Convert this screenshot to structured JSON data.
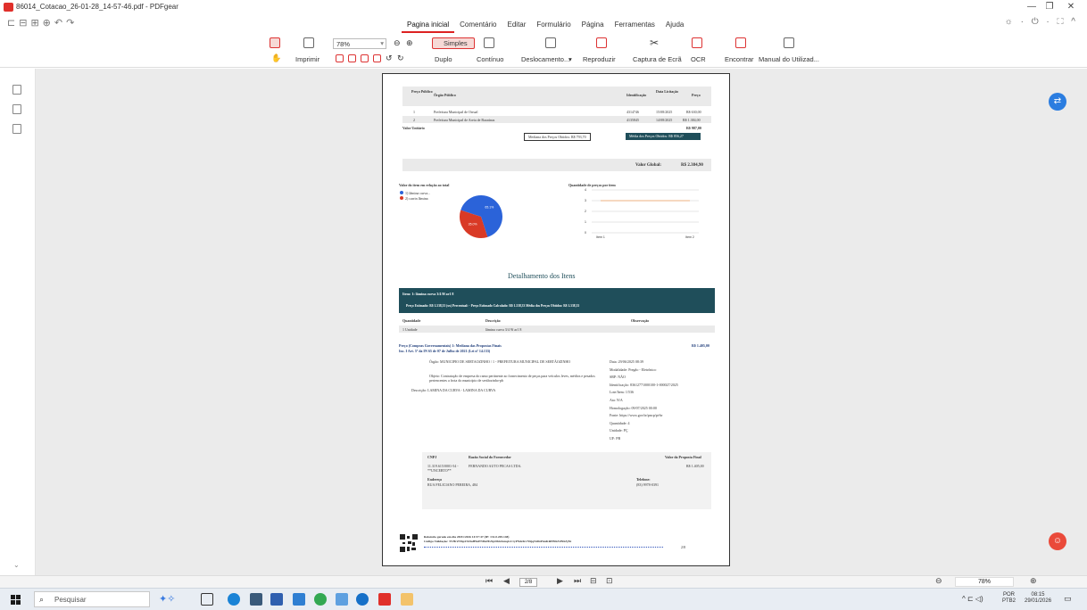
{
  "window": {
    "title": "86014_Cotacao_26-01-28_14-57-46.pdf - PDFgear",
    "logo": "gear",
    "minimize": "—",
    "maximize": "❐",
    "close": "✕"
  },
  "quickbar": {
    "icons": [
      "open-icon",
      "save-icon",
      "print-icon",
      "share-icon",
      "undo-icon",
      "redo-icon"
    ]
  },
  "menu": [
    "Pagina inicial",
    "Comentário",
    "Editar",
    "Formulário",
    "Página",
    "Ferramentas",
    "Ajuda"
  ],
  "right_tools": "☼ · ⏻ · ⛶ ^",
  "ribbon": {
    "zoom": "78%",
    "print": "Imprimir",
    "simples": "Simples",
    "duplo": "Duplo",
    "continuo": "Contínuo",
    "deslocamento": "Deslocamento...",
    "reproduzir": "Reproduzir",
    "captura": "Captura de Ecrã",
    "ocr": "OCR",
    "encontrar": "Encontrar",
    "manual": "Manual do Utilizad..."
  },
  "doc": {
    "t1_head": [
      "Preço Público",
      "Órgão Público",
      "Identificação",
      "Data Licitação",
      "Preço"
    ],
    "t1_rows": [
      [
        "1",
        "Prefeitura Municipal de Orrual",
        "4314746",
        "15/08/2025",
        "R$ 630,00"
      ],
      [
        "2",
        "Prefeitura Municipal de Areia de Baraúnas",
        "4135845",
        "14/08/2025",
        "R$ 1.384,00"
      ]
    ],
    "valor_unitario": "Valor Unitário",
    "valor_unitario_val": "R$ 987,00",
    "mediana": "Mediana dos Preços Obtidos: R$ 793,70",
    "media": "Média dos Preços Obtidos: R$ 856,27",
    "valor_global_label": "Valor Global:",
    "valor_global": "R$ 2.384,90",
    "pie_title": "Valor do item em relação ao total",
    "legend1": "1) lâmina curva...",
    "legend2": "2) carrin lâmina",
    "bar_title": "Quantidade de preços por item",
    "detalhamento": "Detalhamento dos Itens",
    "item_title": "Item: 1: lâmina curva 3/4 9f ar1 8",
    "item_line": "Preço Estimado: R$ 1.538,33 (xx)        Percentual: -        Preço Estimado Calculado: R$ 1.538,33        Média dos Preços Obtidos: R$ 1.538,33",
    "qtd_head": [
      "Quantidade",
      "Descrição",
      "Observação"
    ],
    "qtd_row": [
      "1 Unidade",
      "lâmina curva 3/4 9f ar1 8",
      ""
    ],
    "preco_title": "Preço (Compras Governamentais) 1: Mediana das Propostas Finais",
    "preco_val": "R$ 1.405,00",
    "preco_sub": "Inc. I Art. 5º da IN 65 de 07 de Julho de 2021 (Lei nº 14.133)",
    "orgao": "Órgão:  MUNICIPIO DE SERTAOZINHO / 1 - PREFEITURA MUNICIPAL DE SERTÃOZINHO",
    "objeto": "Objeto:  Contratação de empresa do ramo pertinente ao fornecimento de peças para veículos leves, médios e pesados pertencentes a frota do município de sertãozinho-pb",
    "descricao": "Descrição:  LAMINA DA CURVA - LAMINA DA CURVA",
    "right_info": [
      "Data: 29/06/2025 08:39",
      "Modalidade: Pregão - Eletrônico",
      "SRP: NÃO",
      "Identificação: 83612771000100-1-000027/2025",
      "Lote/Item: 1/536",
      "Ata: N/A",
      "Homologação: 09/07/2025 00:00",
      "Fonte: https://www.gov.br/pncp/pt-br",
      "Quantidade: 4",
      "Unidade: PÇ",
      "UF: PB"
    ],
    "cnpj_head": [
      "CNPJ",
      "Razão Social do Fornecedor",
      "Valor da Proposta Final"
    ],
    "cnpj_row": [
      "11.319.615/0001-54 - **UNCERTO**",
      "FERNANDO AUTO PECAS LTDA.",
      "R$ 1.405,00"
    ],
    "endereco_label": "Endereço",
    "endereco": "RUA FELICIANO PEREIRA, 484",
    "telefone_label": "Telefone:",
    "telefone": "(83) 9978-0391",
    "footer": "Relatório gerado em dia 28/01/2026 14:57:47 (IP: 131.0.205.148)",
    "footer2": "Código Validação: 5VHrZNbpZXDaH9nPNf6xHxNpD6GKmqGC1yPNdzfzv70tjqNdbtPtmKRHN6ZtfN6ZjNt"
  },
  "status": {
    "page": "2/8"
  },
  "zoom_status": "78%",
  "taskbar": {
    "search": "Pesquisar",
    "lang1": "POR",
    "lang2": "PTB2",
    "time": "08:15",
    "date": "29/01/2026"
  },
  "chart_data": [
    {
      "type": "pie",
      "title": "Valor do item em relação ao total",
      "categories": [
        "1) lâmina curva...",
        "2) carrin lâmina"
      ],
      "values": [
        65.1,
        35.0
      ],
      "colors": [
        "#2b63d9",
        "#d93a26"
      ]
    },
    {
      "type": "line",
      "title": "Quantidade de preços por item",
      "categories": [
        "Item 1",
        "Item 2"
      ],
      "series": [
        {
          "values": [
            3,
            3
          ]
        }
      ],
      "ylim": [
        0,
        4
      ],
      "yticks": [
        0,
        1,
        2,
        3,
        4
      ]
    }
  ]
}
